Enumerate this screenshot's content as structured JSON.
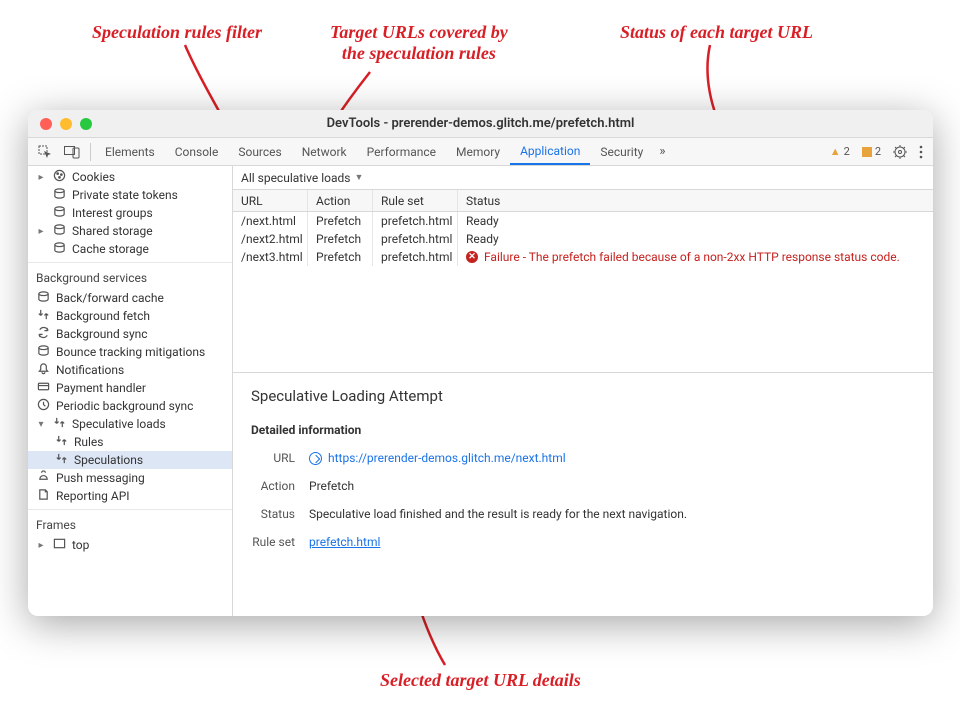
{
  "annotations": {
    "top_left": "Speculation rules filter",
    "top_mid_l1": "Target URLs covered by",
    "top_mid_l2": "the speculation rules",
    "top_right": "Status of each target URL",
    "bottom": "Selected target URL details"
  },
  "titlebar": {
    "title": "DevTools - prerender-demos.glitch.me/prefetch.html"
  },
  "toolbar": {
    "tabs": [
      "Elements",
      "Console",
      "Sources",
      "Network",
      "Performance",
      "Memory",
      "Application",
      "Security"
    ],
    "active_tab": "Application",
    "warn1_count": "2",
    "warn2_count": "2"
  },
  "sidebar": {
    "storage_items": [
      {
        "label": "Cookies",
        "arrow": "▸"
      },
      {
        "label": "Private state tokens"
      },
      {
        "label": "Interest groups"
      },
      {
        "label": "Shared storage",
        "arrow": "▸"
      },
      {
        "label": "Cache storage"
      }
    ],
    "bg_header": "Background services",
    "bg_items": [
      "Back/forward cache",
      "Background fetch",
      "Background sync",
      "Bounce tracking mitigations",
      "Notifications",
      "Payment handler",
      "Periodic background sync"
    ],
    "spec_label": "Speculative loads",
    "spec_children": [
      "Rules",
      "Speculations"
    ],
    "tail_items": [
      "Push messaging",
      "Reporting API"
    ],
    "frames_header": "Frames",
    "frames_top": "top"
  },
  "filter": {
    "label": "All speculative loads"
  },
  "grid": {
    "head": {
      "url": "URL",
      "action": "Action",
      "ruleset": "Rule set",
      "status": "Status"
    },
    "rows": [
      {
        "url": "/next.html",
        "action": "Prefetch",
        "ruleset": "prefetch.html",
        "status": "Ready",
        "err": false
      },
      {
        "url": "/next2.html",
        "action": "Prefetch",
        "ruleset": "prefetch.html",
        "status": "Ready",
        "err": false
      },
      {
        "url": "/next3.html",
        "action": "Prefetch",
        "ruleset": "prefetch.html",
        "status": "Failure - The prefetch failed because of a non-2xx HTTP response status code.",
        "err": true
      }
    ]
  },
  "details": {
    "title": "Speculative Loading Attempt",
    "section": "Detailed information",
    "url_label": "URL",
    "url_value": "https://prerender-demos.glitch.me/next.html",
    "action_label": "Action",
    "action_value": "Prefetch",
    "status_label": "Status",
    "status_value": "Speculative load finished and the result is ready for the next navigation.",
    "ruleset_label": "Rule set",
    "ruleset_value": "prefetch.html"
  }
}
